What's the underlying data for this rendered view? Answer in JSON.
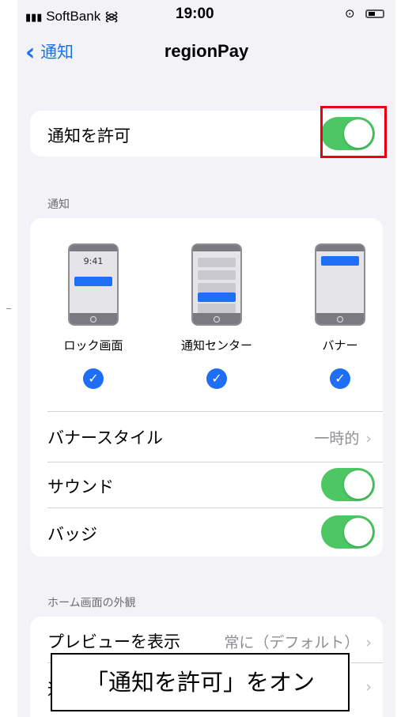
{
  "status_bar": {
    "carrier": "SoftBank",
    "time": "19:00"
  },
  "nav": {
    "back_label": "通知",
    "title": "regionPay"
  },
  "allow_notifications": {
    "label": "通知を許可",
    "enabled": true
  },
  "notifications_section": {
    "header": "通知",
    "styles": [
      {
        "label": "ロック画面",
        "preview_time": "9:41",
        "checked": true
      },
      {
        "label": "通知センター",
        "checked": true
      },
      {
        "label": "バナー",
        "checked": true
      }
    ],
    "rows": [
      {
        "label": "バナースタイル",
        "value": "一時的"
      },
      {
        "label": "サウンド",
        "enabled": true
      },
      {
        "label": "バッジ",
        "enabled": true
      }
    ]
  },
  "home_screen_section": {
    "header": "ホーム画面の外観",
    "rows": [
      {
        "label": "プレビューを表示",
        "value": "常に（デフォルト）"
      },
      {
        "label": "通知"
      }
    ]
  },
  "callout": {
    "text": "「通知を許可」をオン"
  },
  "colors": {
    "toggle_on": "#4cc764",
    "accent": "#1e6ff5",
    "highlight": "#e60012"
  }
}
